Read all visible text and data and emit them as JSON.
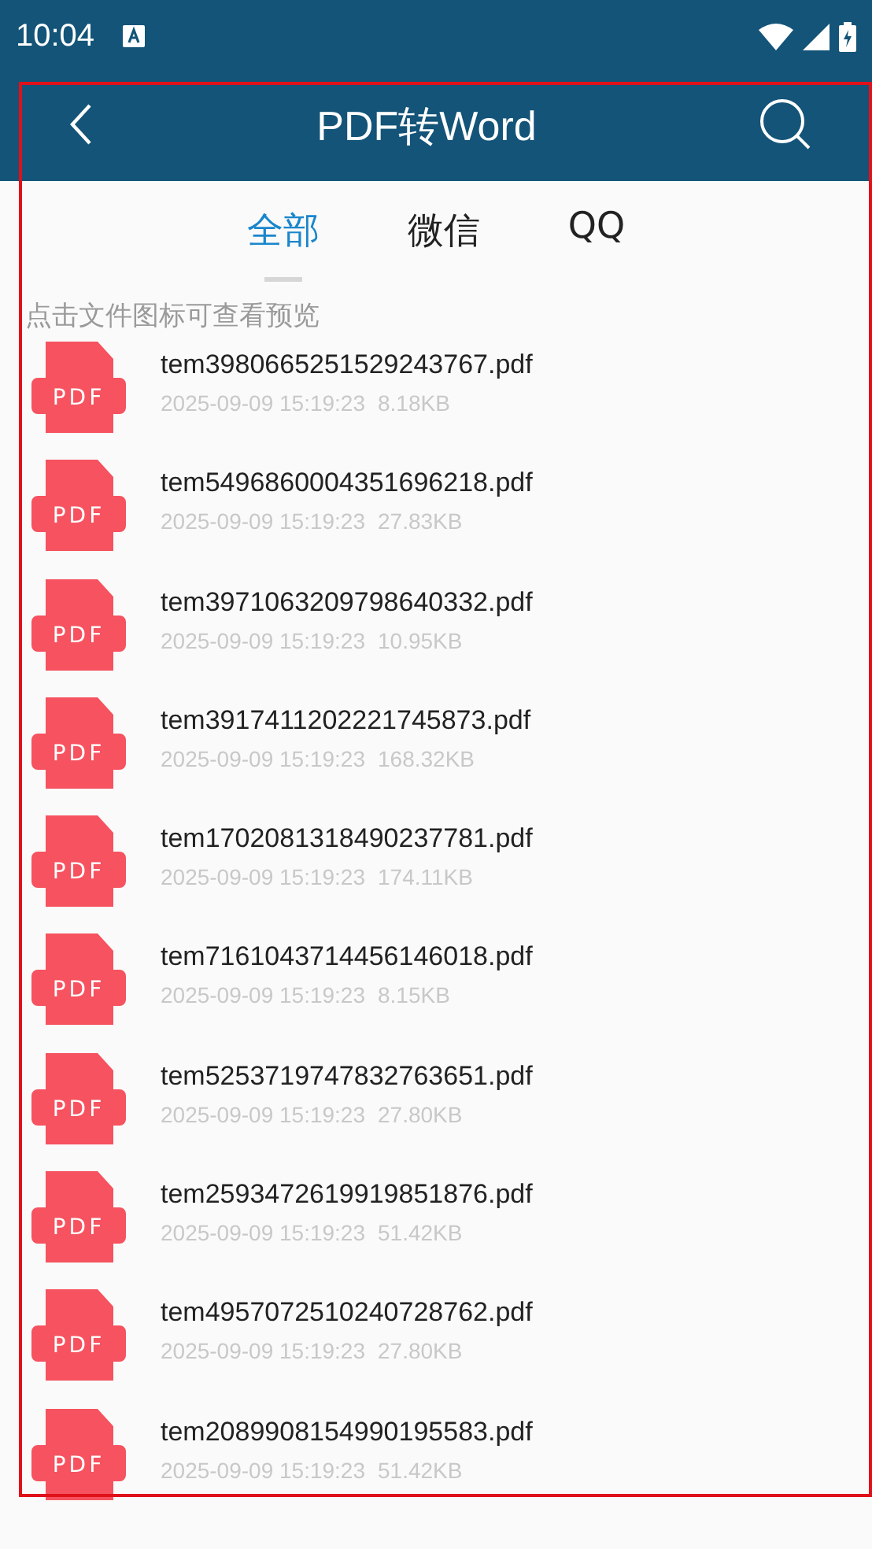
{
  "status_bar": {
    "time": "10:04"
  },
  "toolbar": {
    "title": "PDF转Word"
  },
  "tabs": [
    {
      "label": "全部",
      "selected": true
    },
    {
      "label": "微信",
      "selected": false
    },
    {
      "label": "QQ",
      "selected": false
    }
  ],
  "hint": "点击文件图标可查看预览",
  "files": [
    {
      "icon_label": "PDF",
      "name": "tem3980665251529243767.pdf",
      "date": "2025-09-09 15:19:23",
      "size": "8.18KB"
    },
    {
      "icon_label": "PDF",
      "name": "tem5496860004351696218.pdf",
      "date": "2025-09-09 15:19:23",
      "size": "27.83KB"
    },
    {
      "icon_label": "PDF",
      "name": "tem3971063209798640332.pdf",
      "date": "2025-09-09 15:19:23",
      "size": "10.95KB"
    },
    {
      "icon_label": "PDF",
      "name": "tem3917411202221745873.pdf",
      "date": "2025-09-09 15:19:23",
      "size": "168.32KB"
    },
    {
      "icon_label": "PDF",
      "name": "tem1702081318490237781.pdf",
      "date": "2025-09-09 15:19:23",
      "size": "174.11KB"
    },
    {
      "icon_label": "PDF",
      "name": "tem7161043714456146018.pdf",
      "date": "2025-09-09 15:19:23",
      "size": "8.15KB"
    },
    {
      "icon_label": "PDF",
      "name": "tem5253719747832763651.pdf",
      "date": "2025-09-09 15:19:23",
      "size": "27.80KB"
    },
    {
      "icon_label": "PDF",
      "name": "tem2593472619919851876.pdf",
      "date": "2025-09-09 15:19:23",
      "size": "51.42KB"
    },
    {
      "icon_label": "PDF",
      "name": "tem4957072510240728762.pdf",
      "date": "2025-09-09 15:19:23",
      "size": "27.80KB"
    },
    {
      "icon_label": "PDF",
      "name": "tem2089908154990195583.pdf",
      "date": "2025-09-09 15:19:23",
      "size": "51.42KB"
    }
  ]
}
